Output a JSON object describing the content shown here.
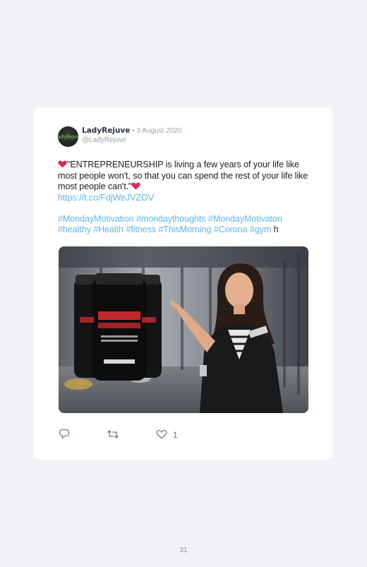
{
  "tweet": {
    "avatar_text": "LadyRejuve",
    "display_name": "LadyRejuve",
    "date": " • 3 August 2020",
    "handle": "@LadyRejuve",
    "text_main": "\"ENTREPRENEURSHIP is living a few years of your life like most people won't, so that you can spend the rest of your life like most people can't.\"",
    "link": "https://t.co/FdjWeJVZOV",
    "hashtags": "#MondayMotivation #mondaythoughts #MondayMotivaton #healthy #Health #fitness #ThisMorning #Corona #gym",
    "hashtags_tail": " h",
    "like_count": "1",
    "media": {
      "product_brand": "LadyRejuva",
      "product_label": "WOMEN 45+"
    }
  },
  "page_number": "31",
  "colors": {
    "link": "#5fb6e8",
    "heart": "#e0245e",
    "background": "#f1f2f5"
  },
  "icons": [
    "reply-icon",
    "retweet-icon",
    "heart-outline-icon",
    "red-heart-icon"
  ]
}
